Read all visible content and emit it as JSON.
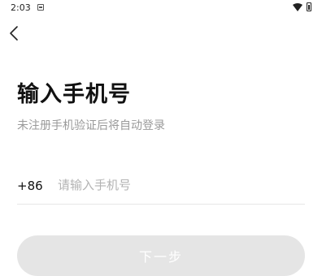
{
  "status_bar": {
    "time": "2:03",
    "icons": [
      "notification-icon",
      "wifi-icon",
      "battery-icon"
    ]
  },
  "nav": {
    "back_icon": "chevron-left-icon"
  },
  "main": {
    "title": "输入手机号",
    "subtitle": "未注册手机验证后将自动登录",
    "country_code": "+86",
    "phone_placeholder": "请输入手机号",
    "phone_value": "",
    "next_label": "下一步"
  },
  "colors": {
    "button_disabled_bg": "#e5e5e5",
    "button_text": "#ffffff",
    "subtitle_text": "#9a9a9a",
    "placeholder_text": "#b3b3b3",
    "divider": "#e6e6e6"
  }
}
